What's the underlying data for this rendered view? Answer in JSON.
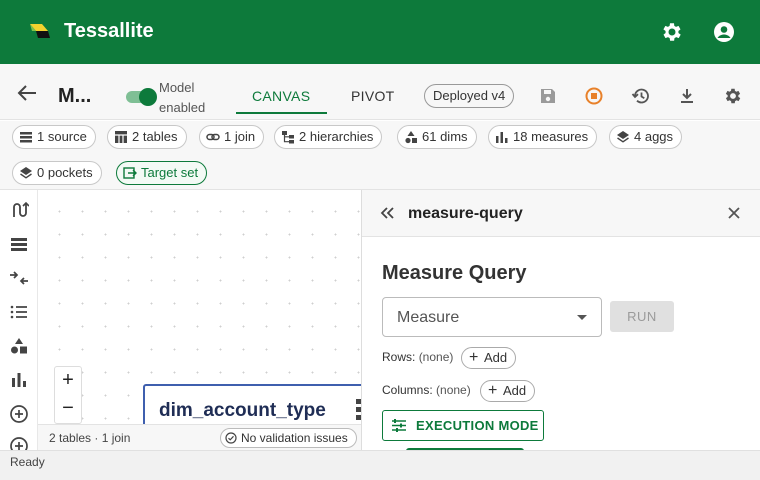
{
  "app": {
    "title": "Tessallite"
  },
  "toolbar": {
    "model_name": "M...",
    "toggle_label": "Model enabled",
    "toggle_on": true,
    "tabs": [
      {
        "label": "CANVAS",
        "active": true
      },
      {
        "label": "PIVOT",
        "active": false
      }
    ],
    "deployed_label": "Deployed v4",
    "icons": [
      "back-arrow-icon",
      "save-icon",
      "stop-icon",
      "history-icon",
      "download-icon",
      "settings-icon"
    ]
  },
  "chips": [
    {
      "label": "1 source",
      "icon": "source-icon"
    },
    {
      "label": "2 tables",
      "icon": "table-icon"
    },
    {
      "label": "1 join",
      "icon": "link-icon"
    },
    {
      "label": "2 hierarchies",
      "icon": "hierarchy-icon"
    },
    {
      "label": "61 dims",
      "icon": "shapes-icon"
    },
    {
      "label": "18 measures",
      "icon": "bar-chart-icon"
    },
    {
      "label": "4 aggs",
      "icon": "layers-icon"
    },
    {
      "label": "0 pockets",
      "icon": "layers-icon"
    },
    {
      "label": "Target set",
      "icon": "export-icon"
    }
  ],
  "canvas": {
    "node_title": "dim_account_type",
    "footer_stats": "2 tables · 1 join",
    "validation": "No validation issues",
    "zoom_in": "+",
    "zoom_out": "−"
  },
  "panel": {
    "title": "measure-query",
    "heading": "Measure Query",
    "select_value": "Measure",
    "run_label": "RUN",
    "rows_label": "Rows:",
    "rows_value": "(none)",
    "columns_label": "Columns:",
    "columns_value": "(none)",
    "add_label": "Add",
    "exec_label": "EXECUTION MODE"
  },
  "status": {
    "text": "Ready"
  },
  "colors": {
    "primary": "#0d7a3b",
    "node_border": "#3f5fae",
    "stop_accent": "#e8812a"
  }
}
